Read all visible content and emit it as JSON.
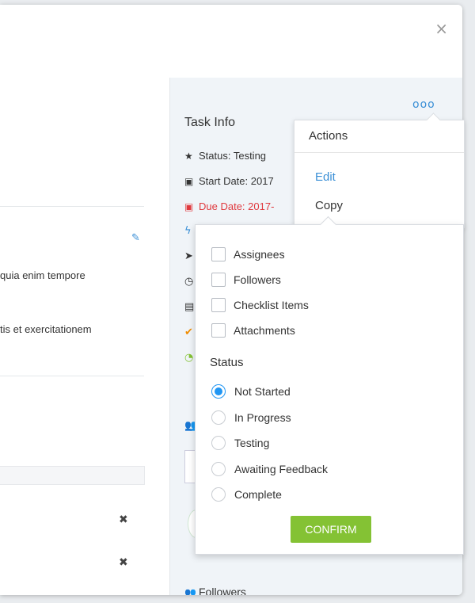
{
  "modal": {
    "close_symbol": "×"
  },
  "left": {
    "edit_icon": "✎",
    "desc_line1": "quia enim tempore",
    "desc_line2": "tis et exercitationem",
    "row_close_symbol": "✖"
  },
  "task_info": {
    "title": "Task Info",
    "more_symbol": "ooo",
    "status": "Status: Testing",
    "start_date": "Start Date: 2017",
    "due_date": "Due Date: 2017-",
    "followers_title": "Followers"
  },
  "actions_menu": {
    "title": "Actions",
    "edit_label": "Edit",
    "copy_label": "Copy"
  },
  "copy_panel": {
    "checkboxes": [
      "Assignees",
      "Followers",
      "Checklist Items",
      "Attachments"
    ],
    "status_heading": "Status",
    "status_options": [
      "Not Started",
      "In Progress",
      "Testing",
      "Awaiting Feedback",
      "Complete"
    ],
    "selected_status": "Not Started",
    "confirm_label": "CONFIRM"
  },
  "colors": {
    "accent_blue": "#3a8fd6",
    "radio_blue": "#2196f3",
    "due_red": "#e0393e",
    "confirm_green": "#84c234"
  }
}
